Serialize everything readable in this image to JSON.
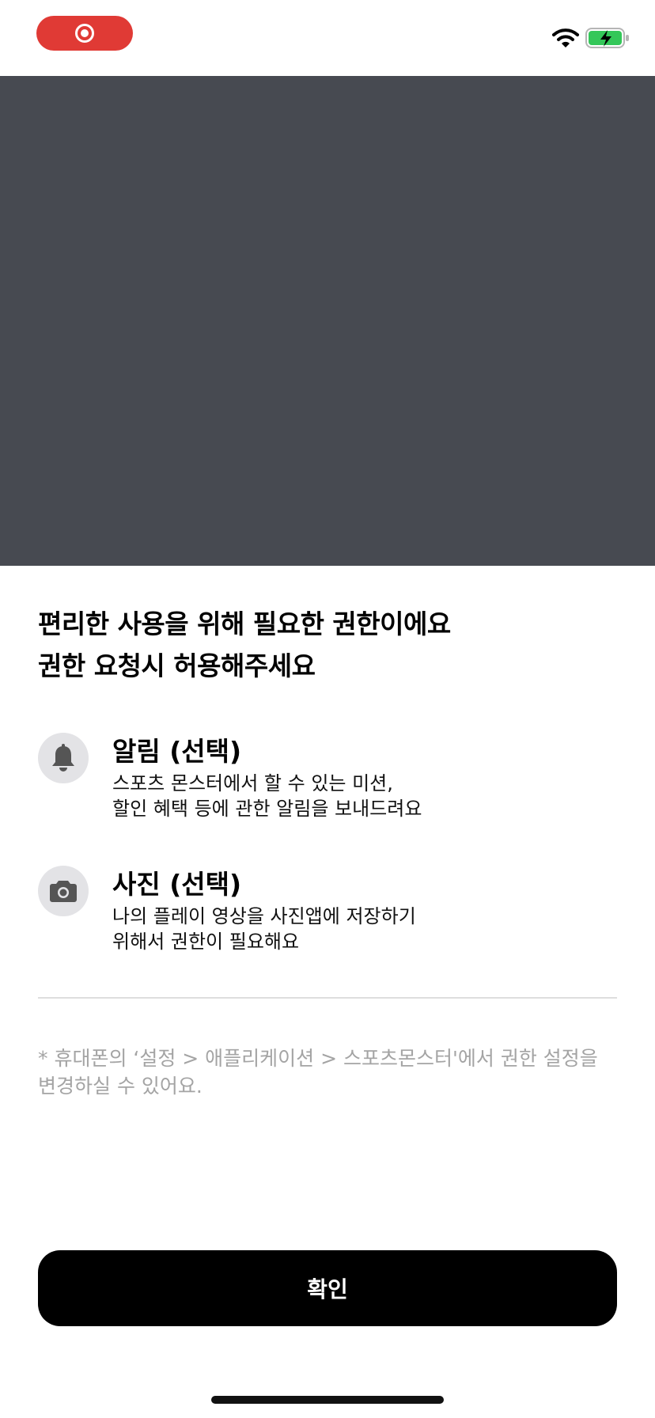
{
  "status_bar": {
    "recording_icon": "screen-record-icon",
    "wifi_icon": "wifi-icon",
    "battery_icon": "battery-charging-icon",
    "colors": {
      "record": "#e03a35",
      "battery": "#34c759"
    }
  },
  "hero": {
    "background": "#474a51"
  },
  "headline": {
    "line1": "편리한 사용을 위해 필요한 권한이에요",
    "line2": "권한 요청시 허용해주세요"
  },
  "permissions": [
    {
      "icon": "bell-icon",
      "title": "알림 (선택)",
      "desc_line1": "스포츠 몬스터에서 할 수 있는 미션,",
      "desc_line2": "할인 혜택 등에 관한 알림을 보내드려요"
    },
    {
      "icon": "camera-icon",
      "title": "사진 (선택)",
      "desc_line1": "나의 플레이 영상을 사진앱에 저장하기",
      "desc_line2": "위해서 권한이 필요해요"
    }
  ],
  "footnote": {
    "line1": "* 휴대폰의 ‘설정 > 애플리케이션 > 스포츠몬스터'에서 권한 설정을",
    "line2": "변경하실 수 있어요."
  },
  "confirm": {
    "label": "확인"
  }
}
